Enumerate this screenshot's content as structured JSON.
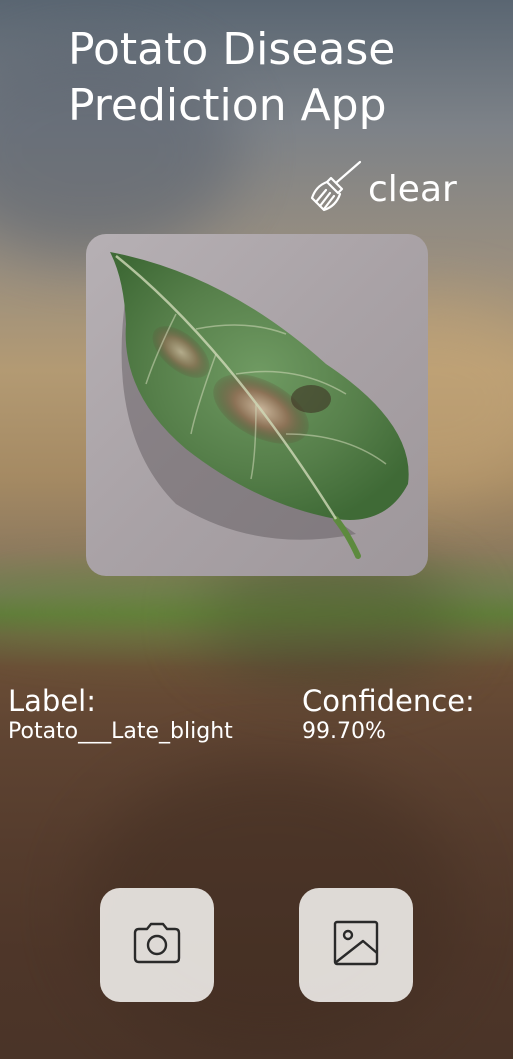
{
  "app": {
    "title": "Potato Disease Prediction App"
  },
  "toolbar": {
    "clear_label": "clear",
    "clear_icon": "broom-icon"
  },
  "preview": {
    "image_subject": "potato-leaf"
  },
  "result": {
    "label_title": "Label:",
    "label_value": "Potato___Late_blight",
    "confidence_title": "Confidence:",
    "confidence_value": "99.70%"
  },
  "actions": {
    "camera_icon": "camera-icon",
    "gallery_icon": "image-icon"
  },
  "colors": {
    "text": "#ffffff",
    "button_bg": "#ece8e5",
    "icon_stroke": "#2a2a2a"
  }
}
